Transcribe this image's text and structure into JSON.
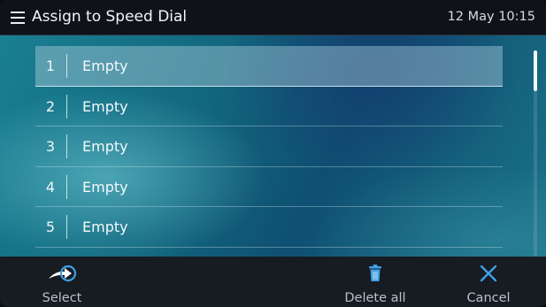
{
  "header": {
    "title": "Assign to Speed Dial",
    "clock": "12 May 10:15",
    "menu_icon": "menu-list-icon"
  },
  "speed_dial_list": {
    "items": [
      {
        "number": "1",
        "label": "Empty",
        "selected": true
      },
      {
        "number": "2",
        "label": "Empty",
        "selected": false
      },
      {
        "number": "3",
        "label": "Empty",
        "selected": false
      },
      {
        "number": "4",
        "label": "Empty",
        "selected": false
      },
      {
        "number": "5",
        "label": "Empty",
        "selected": false
      }
    ]
  },
  "softkeys": {
    "select": {
      "label": "Select",
      "icon": "select-arrow-icon"
    },
    "delete_all": {
      "label": "Delete all",
      "icon": "trash-icon"
    },
    "cancel": {
      "label": "Cancel",
      "icon": "close-icon"
    }
  },
  "colors": {
    "accent": "#3fa0e6",
    "selection": "#8fb8c8"
  }
}
